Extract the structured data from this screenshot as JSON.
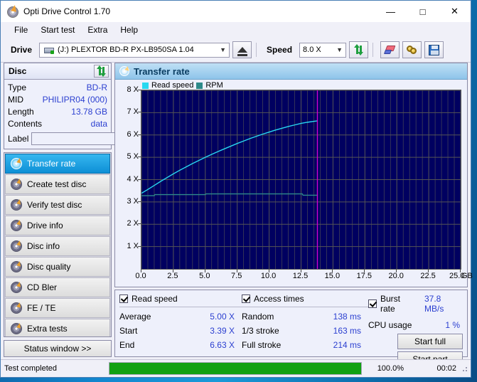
{
  "window": {
    "title": "Opti Drive Control 1.70",
    "icon": "optical-disc-icon",
    "buttons": {
      "minimize": "—",
      "maximize": "□",
      "close": "✕"
    }
  },
  "menu": {
    "items": [
      "File",
      "Start test",
      "Extra",
      "Help"
    ]
  },
  "toolbar": {
    "drive_label": "Drive",
    "drive_value": "(J:)   PLEXTOR BD-R  PX-LB950SA 1.04",
    "eject_icon": "eject-icon",
    "speed_label": "Speed",
    "speed_value": "8.0 X",
    "refresh_icon": "refresh-icon",
    "erase_icon": "erase-disc-icon",
    "bitsetting_icon": "bitsetting-icon",
    "save_icon": "save-icon"
  },
  "disc": {
    "header": "Disc",
    "refresh_icon": "refresh-icon",
    "rows": [
      {
        "key": "Type",
        "value": "BD-R"
      },
      {
        "key": "MID",
        "value": "PHILIPR04 (000)"
      },
      {
        "key": "Length",
        "value": "13.78 GB"
      },
      {
        "key": "Contents",
        "value": "data"
      }
    ],
    "label_key": "Label",
    "label_value": "",
    "label_placeholder": "",
    "disc_icon": "cd-disc-icon"
  },
  "sidebar": {
    "items": [
      {
        "label": "Transfer rate",
        "icon": "disc-icon",
        "active": true
      },
      {
        "label": "Create test disc",
        "icon": "disc-icon",
        "active": false
      },
      {
        "label": "Verify test disc",
        "icon": "disc-icon",
        "active": false
      },
      {
        "label": "Drive info",
        "icon": "disc-icon",
        "active": false
      },
      {
        "label": "Disc info",
        "icon": "disc-icon",
        "active": false
      },
      {
        "label": "Disc quality",
        "icon": "disc-icon",
        "active": false
      },
      {
        "label": "CD Bler",
        "icon": "disc-icon",
        "active": false
      },
      {
        "label": "FE / TE",
        "icon": "disc-icon",
        "active": false
      },
      {
        "label": "Extra tests",
        "icon": "disc-icon",
        "active": false
      }
    ],
    "status_button": "Status window >>"
  },
  "chart_panel": {
    "title": "Transfer rate",
    "icon": "disc-icon"
  },
  "chart_data": {
    "type": "line",
    "title": "Transfer rate",
    "xlabel": "GB",
    "ylabel": "X",
    "xlim": [
      0,
      25
    ],
    "ylim": [
      0,
      8
    ],
    "xticks": [
      "0.0",
      "2.5",
      "5.0",
      "7.5",
      "10.0",
      "12.5",
      "15.0",
      "17.5",
      "20.0",
      "22.5",
      "25.0"
    ],
    "xtick_values": [
      0,
      2.5,
      5,
      7.5,
      10,
      12.5,
      15,
      17.5,
      20,
      22.5,
      25
    ],
    "x_unit": "GB",
    "yticks": [
      "1 X",
      "2 X",
      "3 X",
      "4 X",
      "5 X",
      "6 X",
      "7 X",
      "8 X"
    ],
    "ytick_values": [
      1,
      2,
      3,
      4,
      5,
      6,
      7,
      8
    ],
    "grid": true,
    "legend_position": "top-left",
    "plot_bg": "#000060",
    "grid_color": "#555555",
    "marker": {
      "label": "disc end",
      "x": 13.78,
      "color": "#d000d0"
    },
    "series": [
      {
        "name": "Read speed",
        "color": "#28d8f0",
        "x": [
          0.0,
          0.5,
          1.0,
          1.5,
          2.0,
          2.5,
          3.0,
          3.5,
          4.0,
          4.5,
          5.0,
          5.5,
          6.0,
          6.5,
          7.0,
          7.5,
          8.0,
          8.5,
          9.0,
          9.5,
          10.0,
          10.5,
          11.0,
          11.5,
          12.0,
          12.5,
          13.0,
          13.5,
          13.78
        ],
        "y": [
          3.39,
          3.56,
          3.74,
          3.92,
          4.09,
          4.26,
          4.42,
          4.57,
          4.72,
          4.86,
          5.0,
          5.13,
          5.26,
          5.38,
          5.5,
          5.62,
          5.73,
          5.84,
          5.94,
          6.04,
          6.13,
          6.22,
          6.3,
          6.38,
          6.45,
          6.52,
          6.57,
          6.61,
          6.63
        ]
      },
      {
        "name": "RPM",
        "color": "#2e8a8a",
        "x": [
          0.0,
          1.0,
          1.05,
          5.0,
          5.05,
          12.6,
          12.65,
          13.78
        ],
        "y": [
          3.28,
          3.28,
          3.33,
          3.33,
          3.36,
          3.36,
          3.3,
          3.3
        ]
      }
    ]
  },
  "results": {
    "read_speed": {
      "header": "Read speed",
      "checked": true,
      "rows": [
        {
          "key": "Average",
          "value": "5.00 X"
        },
        {
          "key": "Start",
          "value": "3.39 X"
        },
        {
          "key": "End",
          "value": "6.63 X"
        }
      ]
    },
    "access_times": {
      "header": "Access times",
      "checked": true,
      "rows": [
        {
          "key": "Random",
          "value": "138 ms"
        },
        {
          "key": "1/3 stroke",
          "value": "163 ms"
        },
        {
          "key": "Full stroke",
          "value": "214 ms"
        }
      ]
    },
    "burst": {
      "header": "Burst rate",
      "checked": true,
      "burst_value": "37.8 MB/s",
      "cpu_key": "CPU usage",
      "cpu_value": "1 %",
      "start_full": "Start full",
      "start_part": "Start part"
    }
  },
  "statusbar": {
    "text": "Test completed",
    "percent_label": "100.0%",
    "percent_value": 100,
    "time": "00:02",
    "bar_color": "#12a012"
  }
}
